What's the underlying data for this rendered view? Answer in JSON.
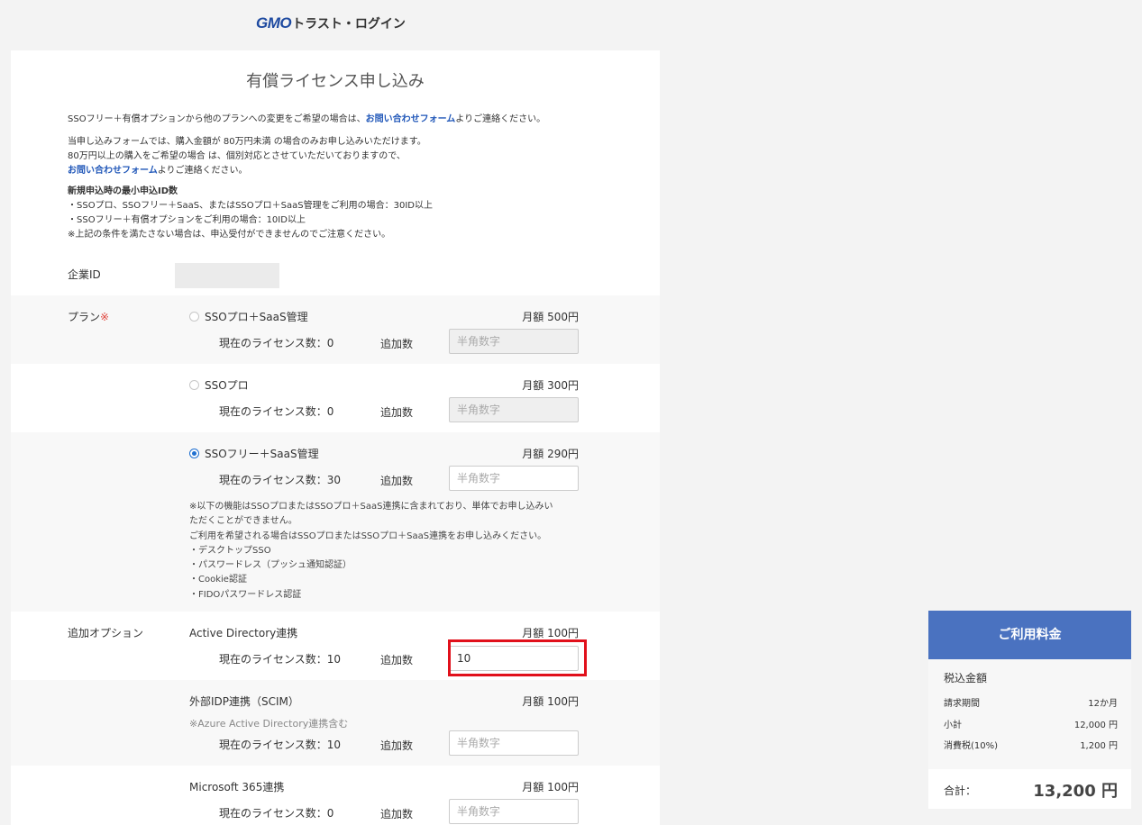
{
  "logo": {
    "brand": "GMO",
    "name": "トラスト・ログイン"
  },
  "page": {
    "title": "有償ライセンス申し込み"
  },
  "intro": {
    "line1_a": "SSOフリー＋有償オプションから他のプランへの変更をご希望の場合は、",
    "line1_link": "お問い合わせフォーム",
    "line1_b": "よりご連絡ください。",
    "line2": "当申し込みフォームでは、購入金額が 80万円未満 の場合のみお申し込みいただけます。",
    "line3": "80万円以上の購入をご希望の場合 は、個別対応とさせていただいておりますので、",
    "line4_link": "お問い合わせフォーム",
    "line4_b": "よりご連絡ください。",
    "min_title": "新規申込時の最小申込ID数",
    "min1": "・SSOプロ、SSOフリー＋SaaS、またはSSOプロ＋SaaS管理をご利用の場合：30ID以上",
    "min2": "・SSOフリー＋有償オプションをご利用の場合：10ID以上",
    "min3": "※上記の条件を満たさない場合は、申込受付ができませんのでご注意ください。"
  },
  "company": {
    "label": "企業ID",
    "value": ""
  },
  "plan": {
    "label": "プラン",
    "required_mark": "※",
    "items": [
      {
        "name": "SSOプロ＋SaaS管理",
        "price": "月額 500円",
        "current": "現在のライセンス数：0",
        "add_label": "追加数",
        "placeholder": "半角数字",
        "value": "",
        "checked": false
      },
      {
        "name": "SSOプロ",
        "price": "月額 300円",
        "current": "現在のライセンス数：0",
        "add_label": "追加数",
        "placeholder": "半角数字",
        "value": "",
        "checked": false
      },
      {
        "name": "SSOフリー＋SaaS管理",
        "price": "月額 290円",
        "current": "現在のライセンス数：30",
        "add_label": "追加数",
        "placeholder": "半角数字",
        "value": "",
        "checked": true
      }
    ],
    "note": [
      "※以下の機能はSSOプロまたはSSOプロ＋SaaS連携に含まれており、単体でお申し込みい",
      "ただくことができません。",
      "ご利用を希望される場合はSSOプロまたはSSOプロ＋SaaS連携をお申し込みください。",
      "・デスクトップSSO",
      "・パスワードレス（プッシュ通知認証）",
      "・Cookie認証",
      "・FIDOパスワードレス認証"
    ]
  },
  "options": {
    "label": "追加オプション",
    "items": [
      {
        "name": "Active Directory連携",
        "price": "月額 100円",
        "current": "現在のライセンス数：10",
        "add_label": "追加数",
        "placeholder": "半角数字",
        "value": "10",
        "sub": ""
      },
      {
        "name": "外部IDP連携（SCIM）",
        "price": "月額 100円",
        "current": "現在のライセンス数：10",
        "add_label": "追加数",
        "placeholder": "半角数字",
        "value": "",
        "sub": "※Azure Active Directory連携含む"
      },
      {
        "name": "Microsoft 365連携",
        "price": "月額 100円",
        "current": "現在のライセンス数：0",
        "add_label": "追加数",
        "placeholder": "半角数字",
        "value": "",
        "sub": ""
      }
    ]
  },
  "fee": {
    "title": "ご利用料金",
    "tax_label": "税込金額",
    "period_label": "請求期間",
    "period_value": "12か月",
    "subtotal_label": "小計",
    "subtotal_value": "12,000 円",
    "tax_row_label": "消費税(10%)",
    "tax_row_value": "1,200 円",
    "total_label": "合計：",
    "total_value": "13,200 円"
  },
  "colors": {
    "accent": "#4a72c0",
    "link": "#1f56b8",
    "highlight": "#e1101b",
    "required": "#e0473f"
  }
}
